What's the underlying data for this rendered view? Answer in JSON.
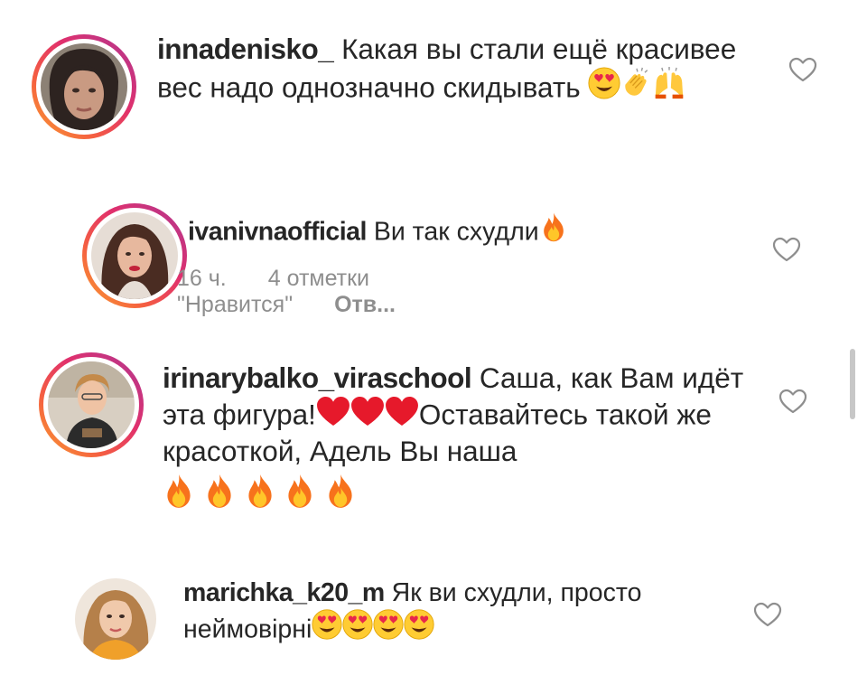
{
  "comments": [
    {
      "username": "innadenisko_",
      "text": " Какая вы стали ещё красивее вес надо однозначно скидывать"
    },
    {
      "username": "ivanivnaofficial",
      "text": " Ви так схудли",
      "time": "16 ч.",
      "likes": "4 отметки \"Нравится\"",
      "reply": "Отв..."
    },
    {
      "username": "irinarybalko_viraschool",
      "text": " Саша, как Вам идёт эта фигура!",
      "text_after_hearts": "Оставайтесь такой же красоткой, Адель Вы наша"
    },
    {
      "username": "marichka_k20_m",
      "text": " Як ви схудли, просто неймовірні"
    }
  ],
  "icons": {
    "like": "heart-outline-icon",
    "emoji_love": "heart-eyes-emoji",
    "emoji_clap": "clapping-hands-emoji",
    "emoji_raise": "raising-hands-emoji",
    "emoji_fire": "fire-emoji",
    "emoji_heart": "red-heart-emoji"
  },
  "colors": {
    "username": "#262626",
    "text": "#262626",
    "meta": "#8e8e8e",
    "story_ring_start": "#f9a131",
    "story_ring_end": "#b62c95"
  }
}
